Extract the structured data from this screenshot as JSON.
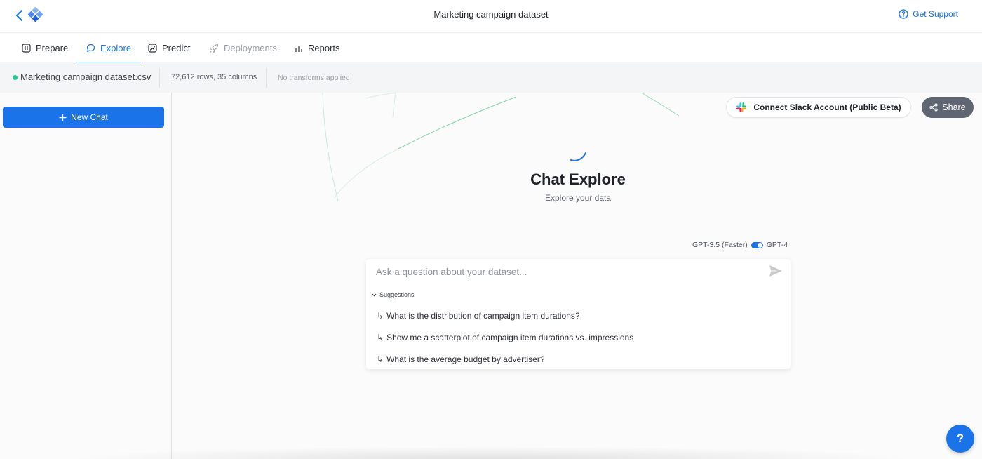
{
  "header": {
    "title": "Marketing campaign dataset",
    "support_label": "Get Support",
    "back_icon": "chevron-left-icon",
    "logo_icon": "diamond-logo-icon"
  },
  "tabs": [
    {
      "label": "Prepare",
      "icon": "prepare-icon",
      "state": "normal"
    },
    {
      "label": "Explore",
      "icon": "chat-bubble-icon",
      "state": "active"
    },
    {
      "label": "Predict",
      "icon": "predict-icon",
      "state": "normal"
    },
    {
      "label": "Deployments",
      "icon": "rocket-icon",
      "state": "disabled"
    },
    {
      "label": "Reports",
      "icon": "bar-chart-icon",
      "state": "normal"
    }
  ],
  "dataset": {
    "file_name": "Marketing campaign dataset.csv",
    "shape": "72,612 rows, 35 columns",
    "transforms": "No transforms applied",
    "status_color": "#2bc48a"
  },
  "sidebar": {
    "new_chat_label": "New Chat"
  },
  "actions": {
    "slack_label": "Connect Slack Account (Public Beta)",
    "share_label": "Share"
  },
  "chat": {
    "title": "Chat Explore",
    "subtitle": "Explore your data",
    "model_left": "GPT-3.5 (Faster)",
    "model_right": "GPT-4",
    "input_placeholder": "Ask a question about your dataset...",
    "suggestions_label": "Suggestions",
    "suggestions": [
      "What is the distribution of campaign item durations?",
      "Show me a scatterplot of campaign item durations vs. impressions",
      "What is the average budget by advertiser?"
    ]
  },
  "help": {
    "label": "?"
  },
  "colors": {
    "accent": "#1a73e8",
    "share_bg": "#5f6672"
  }
}
